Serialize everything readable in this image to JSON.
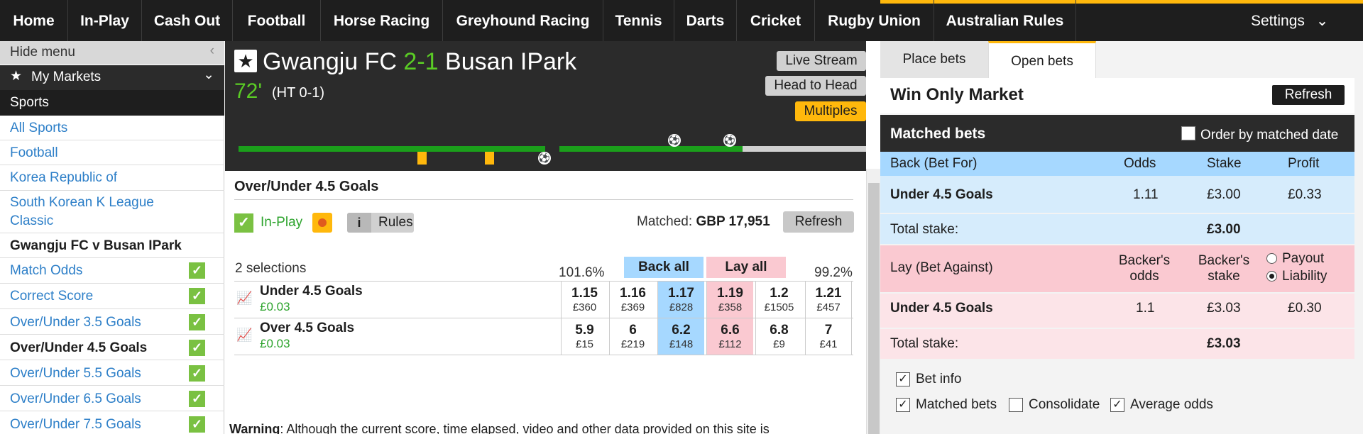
{
  "nav": {
    "items": [
      "Home",
      "In-Play",
      "Cash Out",
      "Football",
      "Horse Racing",
      "Greyhound Racing",
      "Tennis",
      "Darts",
      "Cricket",
      "Rugby Union",
      "Australian Rules"
    ],
    "settings": "Settings"
  },
  "sidebar": {
    "hide_menu": "Hide menu",
    "my_markets": "My Markets",
    "sports": "Sports",
    "links": [
      "All Sports",
      "Football",
      "Korea Republic of",
      "South Korean K League",
      "Classic"
    ],
    "event": "Gwangju FC v Busan IPark",
    "markets": [
      "Match Odds",
      "Correct Score",
      "Over/Under 3.5 Goals",
      "Over/Under 4.5 Goals",
      "Over/Under 5.5 Goals",
      "Over/Under 6.5 Goals",
      "Over/Under 7.5 Goals"
    ]
  },
  "event": {
    "home": "Gwangju FC",
    "score": "2-1",
    "away": "Busan IPark",
    "minute": "72'",
    "ht": "(HT 0-1)",
    "live_stream": "Live Stream",
    "head_to_head": "Head to Head",
    "multiples": "Multiples"
  },
  "market": {
    "title": "Over/Under 4.5 Goals",
    "in_play": "In-Play",
    "rules": "Rules",
    "matched_label": "Matched:",
    "matched_value": "GBP 17,951",
    "refresh": "Refresh",
    "selections": "2 selections",
    "back_pct": "101.6%",
    "lay_pct": "99.2%",
    "back_all": "Back all",
    "lay_all": "Lay all",
    "runners": [
      {
        "name": "Under 4.5 Goals",
        "pl": "£0.03",
        "prices": [
          [
            "1.15",
            "£360"
          ],
          [
            "1.16",
            "£369"
          ],
          [
            "1.17",
            "£828"
          ],
          [
            "1.19",
            "£358"
          ],
          [
            "1.2",
            "£1505"
          ],
          [
            "1.21",
            "£457"
          ]
        ]
      },
      {
        "name": "Over 4.5 Goals",
        "pl": "£0.03",
        "prices": [
          [
            "5.9",
            "£15"
          ],
          [
            "6",
            "£219"
          ],
          [
            "6.2",
            "£148"
          ],
          [
            "6.6",
            "£112"
          ],
          [
            "6.8",
            "£9"
          ],
          [
            "7",
            "£41"
          ]
        ]
      }
    ],
    "warning_label": "Warning",
    "warning_text": ": Although the current score, time elapsed, video and other data provided on this site is"
  },
  "betslip": {
    "tab_place": "Place bets",
    "tab_open": "Open bets",
    "market": "Win Only Market",
    "refresh": "Refresh",
    "matched_bets": "Matched bets",
    "order_label": "Order by matched date",
    "back_header": {
      "label": "Back (Bet For)",
      "odds": "Odds",
      "stake": "Stake",
      "profit": "Profit"
    },
    "back_row": {
      "name": "Under 4.5 Goals",
      "odds": "1.11",
      "stake": "£3.00",
      "profit": "£0.33"
    },
    "back_total": {
      "label": "Total stake:",
      "value": "£3.00"
    },
    "lay_header": {
      "label": "Lay (Bet Against)",
      "odds1": "Backer's",
      "odds2": "odds",
      "stake1": "Backer's",
      "stake2": "stake",
      "payout": "Payout",
      "liability": "Liability"
    },
    "lay_row": {
      "name": "Under 4.5 Goals",
      "odds": "1.1",
      "stake": "£3.03",
      "profit": "£0.30"
    },
    "lay_total": {
      "label": "Total stake:",
      "value": "£3.03"
    },
    "options": {
      "bet_info": "Bet info",
      "matched_bets": "Matched bets",
      "consolidate": "Consolidate",
      "average_odds": "Average odds"
    }
  },
  "colors": {
    "accent": "#ffb80c",
    "back": "#a6d8ff",
    "lay": "#fac9d1",
    "green": "#5acb25",
    "dark": "#2b2b2b"
  }
}
